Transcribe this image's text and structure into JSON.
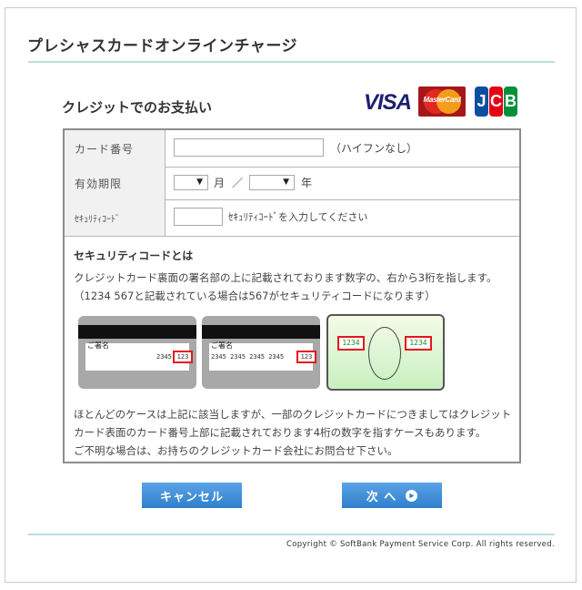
{
  "page": {
    "title": "プレシャスカードオンラインチャージ"
  },
  "section": {
    "subtitle": "クレジットでのお支払い"
  },
  "brands": {
    "visa": "VISA",
    "mastercard": "MasterCard",
    "jcb_j": "J",
    "jcb_c": "C",
    "jcb_b": "B"
  },
  "form": {
    "card_number_label": "カード番号",
    "card_number_value": "",
    "card_number_hint": "（ハイフンなし）",
    "expiry_label": "有効期限",
    "month_value": "",
    "month_unit": "月",
    "slash": "／",
    "year_value": "",
    "year_unit": "年",
    "security_label": "ｾｷｭﾘﾃｨｺｰﾄﾞ",
    "security_value": "",
    "security_hint": "ｾｷｭﾘﾃｨｺｰﾄﾞを入力してください"
  },
  "info": {
    "title": "セキュリティコードとは",
    "text_line1": "クレジットカード裏面の署名部の上に記載されております数字の、右から3桁を指します。",
    "text_line2": "（1234 567と記載されている場合は567がセキュリティコードになります）",
    "bottom_line1": "ほとんどのケースは上記に該当しますが、一部のクレジットカードにつきましてはクレジット",
    "bottom_line2": "カード表面のカード番号上部に記載されております4桁の数字を指すケースもあります。",
    "bottom_line3": "ご不明な場合は、お持ちのクレジットカード会社にお問合せ下さい。"
  },
  "cards": {
    "sign_label": "ご署名",
    "card1_number": "2345",
    "card1_code": "123",
    "card2_number": "2345 2345 2345 2345",
    "card2_code": "123",
    "card3_code_left": "1234",
    "card3_code_right": "1234"
  },
  "buttons": {
    "cancel": "キャンセル",
    "next": "次 へ"
  },
  "footer": {
    "copyright": "Copyright © SoftBank Payment Service Corp. All rights reserved."
  },
  "colors": {
    "accent_line": "#b9dde3",
    "button": "#3a8ad6",
    "code_box": "#e8141c"
  }
}
